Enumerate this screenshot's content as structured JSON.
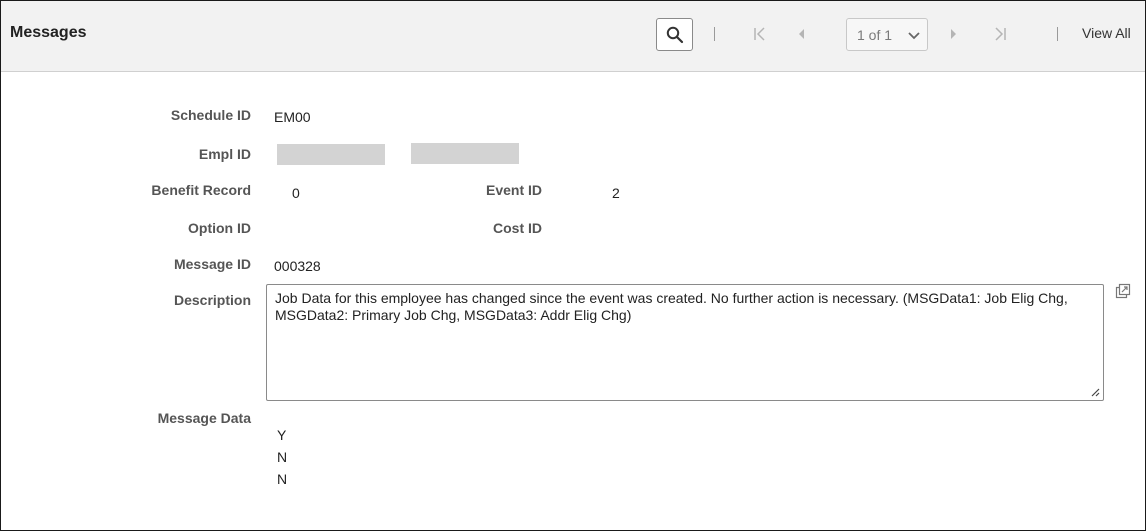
{
  "header": {
    "title": "Messages",
    "search_icon": "search-icon",
    "page_indicator": "1 of 1",
    "view_all": "View All"
  },
  "fields": {
    "schedule_id": {
      "label": "Schedule ID",
      "value": "EM00"
    },
    "empl_id": {
      "label": "Empl ID"
    },
    "benefit_record": {
      "label": "Benefit Record",
      "value": "0"
    },
    "event_id": {
      "label": "Event ID",
      "value": "2"
    },
    "option_id": {
      "label": "Option ID"
    },
    "cost_id": {
      "label": "Cost ID"
    },
    "message_id": {
      "label": "Message ID",
      "value": "000328"
    },
    "description": {
      "label": "Description",
      "value": "Job Data for this employee has changed since the event was created.  No further action is necessary.  (MSGData1: Job Elig Chg, MSGData2: Primary Job Chg, MSGData3: Addr Elig Chg)"
    },
    "message_data": {
      "label": "Message Data",
      "values": [
        "Y",
        "N",
        "N"
      ]
    }
  },
  "colors": {
    "header_bg": "#f2f2f2",
    "label": "#555555",
    "redaction": "#d3d3d3",
    "nav_disabled": "#b5b5b5"
  }
}
